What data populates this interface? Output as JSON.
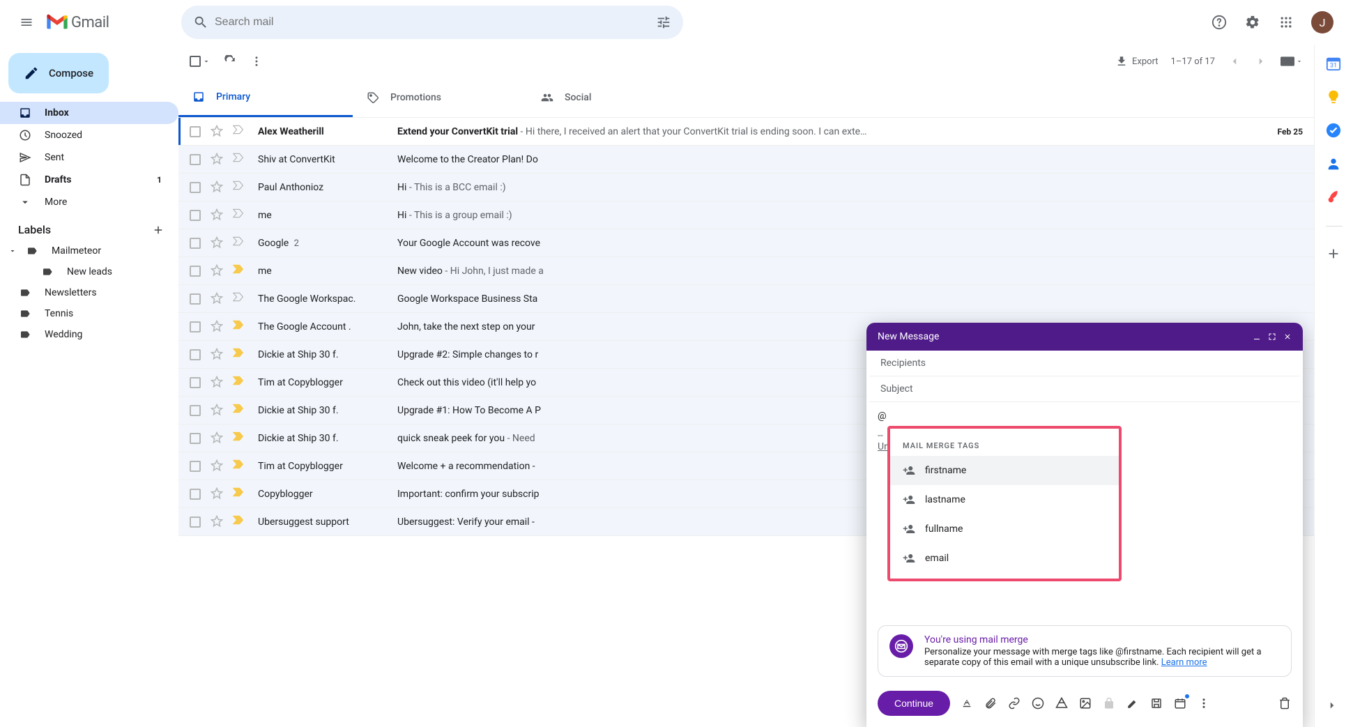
{
  "app": {
    "logo_text": "Gmail",
    "search_placeholder": "Search mail",
    "avatar_initial": "J"
  },
  "compose_btn": "Compose",
  "nav": {
    "inbox": "Inbox",
    "snoozed": "Snoozed",
    "sent": "Sent",
    "drafts": "Drafts",
    "drafts_count": "1",
    "more": "More"
  },
  "labels": {
    "heading": "Labels",
    "mailmeteor": "Mailmeteor",
    "newleads": "New leads",
    "newsletters": "Newsletters",
    "tennis": "Tennis",
    "wedding": "Wedding"
  },
  "toolbar": {
    "export": "Export",
    "range": "1–17 of 17"
  },
  "tabs": {
    "primary": "Primary",
    "promotions": "Promotions",
    "social": "Social"
  },
  "rows": [
    {
      "sender": "Alex Weatherill",
      "count": "",
      "subj": "Extend your ConvertKit trial",
      "snip": " - Hi there, I received an alert that your ConvertKit trial is ending soon. I can exte…",
      "date": "Feb 25",
      "unread": true,
      "imp": true,
      "y": false
    },
    {
      "sender": "Shiv at ConvertKit",
      "count": "",
      "subj": "Welcome to the Creator Plan! Do",
      "snip": "",
      "date": "",
      "unread": false,
      "imp": true,
      "y": false
    },
    {
      "sender": "Paul Anthonioz",
      "count": "",
      "subj": "Hi",
      "snip": " - This is a BCC email :)",
      "date": "",
      "unread": false,
      "imp": true,
      "y": false
    },
    {
      "sender": "me",
      "count": "",
      "subj": "Hi",
      "snip": " - This is a group email :)",
      "date": "",
      "unread": false,
      "imp": true,
      "y": false
    },
    {
      "sender": "Google",
      "count": "2",
      "subj": "Your Google Account was recove",
      "snip": "",
      "date": "",
      "unread": false,
      "imp": true,
      "y": false
    },
    {
      "sender": "me",
      "count": "",
      "subj": "New video",
      "snip": " - Hi John, I just made a",
      "date": "",
      "unread": false,
      "imp": true,
      "y": true
    },
    {
      "sender": "The Google Workspac.",
      "count": "",
      "subj": "Google Workspace Business Sta",
      "snip": "",
      "date": "",
      "unread": false,
      "imp": true,
      "y": false
    },
    {
      "sender": "The Google Account .",
      "count": "",
      "subj": "John, take the next step on your",
      "snip": "",
      "date": "",
      "unread": false,
      "imp": true,
      "y": true
    },
    {
      "sender": "Dickie at Ship 30 f.",
      "count": "",
      "subj": "Upgrade #2: Simple changes to r",
      "snip": "",
      "date": "",
      "unread": false,
      "imp": true,
      "y": true
    },
    {
      "sender": "Tim at Copyblogger",
      "count": "",
      "subj": "Check out this video (it'll help yo",
      "snip": "",
      "date": "",
      "unread": false,
      "imp": true,
      "y": true
    },
    {
      "sender": "Dickie at Ship 30 f.",
      "count": "",
      "subj": "Upgrade #1: How To Become A P",
      "snip": "",
      "date": "",
      "unread": false,
      "imp": true,
      "y": true
    },
    {
      "sender": "Dickie at Ship 30 f.",
      "count": "",
      "subj": "quick sneak peek for you",
      "snip": " - Need",
      "date": "",
      "unread": false,
      "imp": true,
      "y": true
    },
    {
      "sender": "Tim at Copyblogger",
      "count": "",
      "subj": "Welcome + a recommendation -",
      "snip": "",
      "date": "",
      "unread": false,
      "imp": true,
      "y": true
    },
    {
      "sender": "Copyblogger",
      "count": "",
      "subj": "Important: confirm your subscrip",
      "snip": "",
      "date": "",
      "unread": false,
      "imp": true,
      "y": true
    },
    {
      "sender": "Ubersuggest support",
      "count": "",
      "subj": "Ubersuggest: Verify your email -",
      "snip": "",
      "date": "",
      "unread": false,
      "imp": true,
      "y": true
    }
  ],
  "composer": {
    "title": "New Message",
    "recipients": "Recipients",
    "subject": "Subject",
    "body_at": "@",
    "sig_dash": "--",
    "sig_un": "Un",
    "merge_heading": "MAIL MERGE TAGS",
    "merge_items": {
      "firstname": "firstname",
      "lastname": "lastname",
      "fullname": "fullname",
      "email": "email"
    },
    "info_title": "You're using mail merge",
    "info_body": "Personalize your message with merge tags like @firstname. Each recipient will get a separate copy of this email with a unique unsubscribe link. ",
    "info_link": "Learn more",
    "send": "Continue"
  }
}
